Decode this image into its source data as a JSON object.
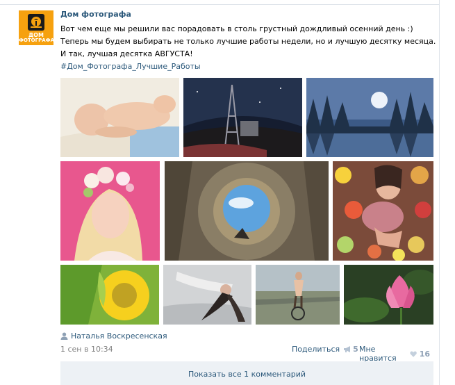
{
  "post": {
    "author": "Дом фотографа",
    "avatar": {
      "line1": "ДОМ",
      "line2": "ФОТОГРАФА"
    },
    "text_lines": [
      "Вот чем еще мы решили вас порадовать в столь грустный дождливый осенний день :)",
      "Теперь мы будем выбирать не только лучшие работы недели, но и лучшую десятку месяца.",
      "И так, лучшая десятка АВГУСТА!"
    ],
    "hashtag": "#Дом_Фотографа_Лучшие_Работы",
    "photos": [
      {
        "name": "photo-sleeping-baby"
      },
      {
        "name": "photo-night-tower"
      },
      {
        "name": "photo-misty-lake"
      },
      {
        "name": "photo-girl-flower-wreath"
      },
      {
        "name": "photo-tiny-planet"
      },
      {
        "name": "photo-woman-in-flowers"
      },
      {
        "name": "photo-sunflower"
      },
      {
        "name": "photo-woman-lying"
      },
      {
        "name": "photo-cyclist"
      },
      {
        "name": "photo-lotus"
      }
    ],
    "signer": "Наталья Воскресенская",
    "date": "1 сен в 10:34",
    "share_label": "Поделиться",
    "share_count": "5",
    "like_label": "Мне нравится",
    "like_count": "16",
    "comments_label": "Показать все 1 комментарий",
    "icons": [
      "avatar-logo-icon",
      "person-icon",
      "megaphone-icon",
      "heart-icon"
    ],
    "colors": {
      "link": "#2b587a",
      "counter": "#8fa1b5",
      "date": "#808080",
      "avatar_bg": "#f6a10f",
      "comments_bg": "#edf1f5"
    }
  }
}
